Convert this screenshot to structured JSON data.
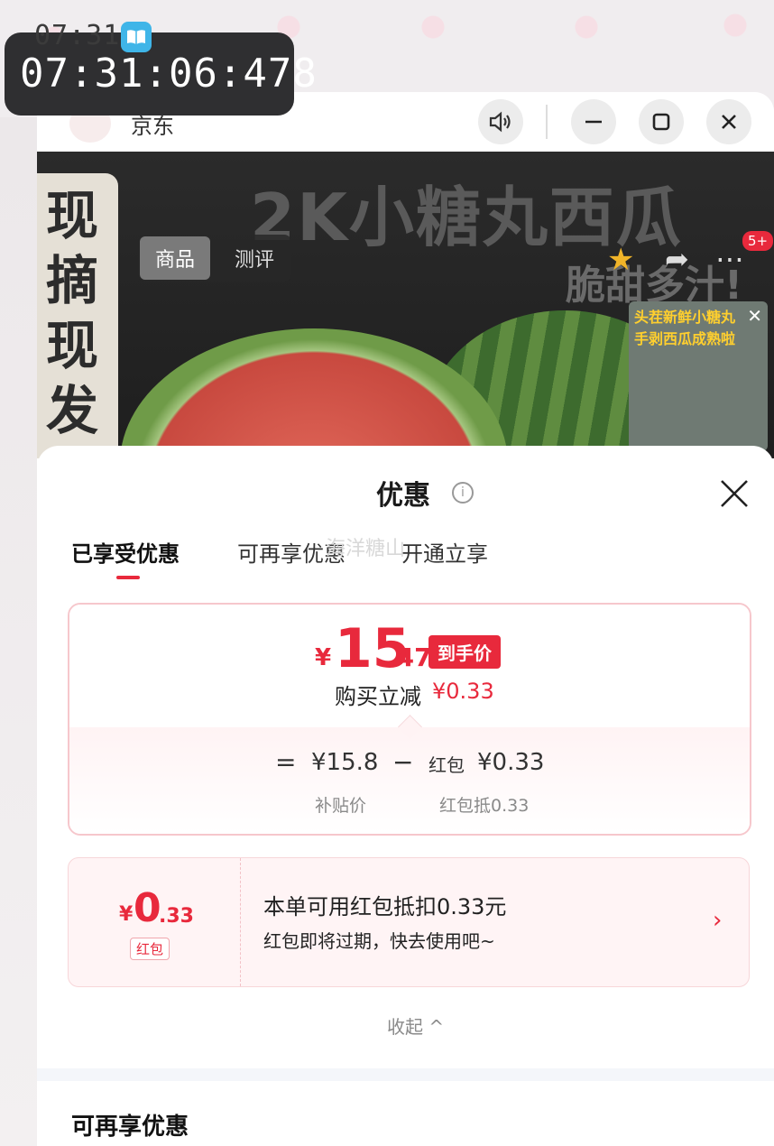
{
  "overlay": {
    "clock_small": "07:31",
    "clock_big": "07:31:06:478"
  },
  "app": {
    "name": "京东",
    "window_buttons": [
      "speaker-icon",
      "minimize-icon",
      "maximize-icon",
      "close-icon"
    ]
  },
  "hero": {
    "title": "2K小糖丸西瓜",
    "subtitle": "脆甜多汁!",
    "side_text": [
      "现",
      "摘",
      "现",
      "发"
    ],
    "tabs": [
      "商品",
      "测评"
    ],
    "badge": "5+",
    "video_lines": [
      "头茬新鲜小糖丸",
      "手剥西瓜成熟啦"
    ]
  },
  "sheet": {
    "title": "优惠",
    "tabs": [
      "已享受优惠",
      "可再享优惠",
      "开通立享"
    ],
    "watermark": "海洋糖山",
    "price": {
      "yen": "¥",
      "int": "15",
      "dec": ".47",
      "tag": "到手价",
      "reduce_label": "购买立减",
      "reduce_value": "¥0.33",
      "eq": "=",
      "sub_price": "¥15.8",
      "minus": "−",
      "redpacket_label": "红包",
      "redpacket_value": "¥0.33",
      "sub_note": "补贴价",
      "redpacket_note": "红包抵0.33"
    },
    "coupon": {
      "yen": "¥",
      "int": "0",
      "dec": ".33",
      "tag": "红包",
      "title": "本单可用红包抵扣0.33元",
      "desc": "红包即将过期，快去使用吧~"
    },
    "collapse": "收起 ^",
    "section_title": "可再享优惠"
  },
  "colors": {
    "accent": "#e8293c",
    "border": "#f6c7cc"
  }
}
